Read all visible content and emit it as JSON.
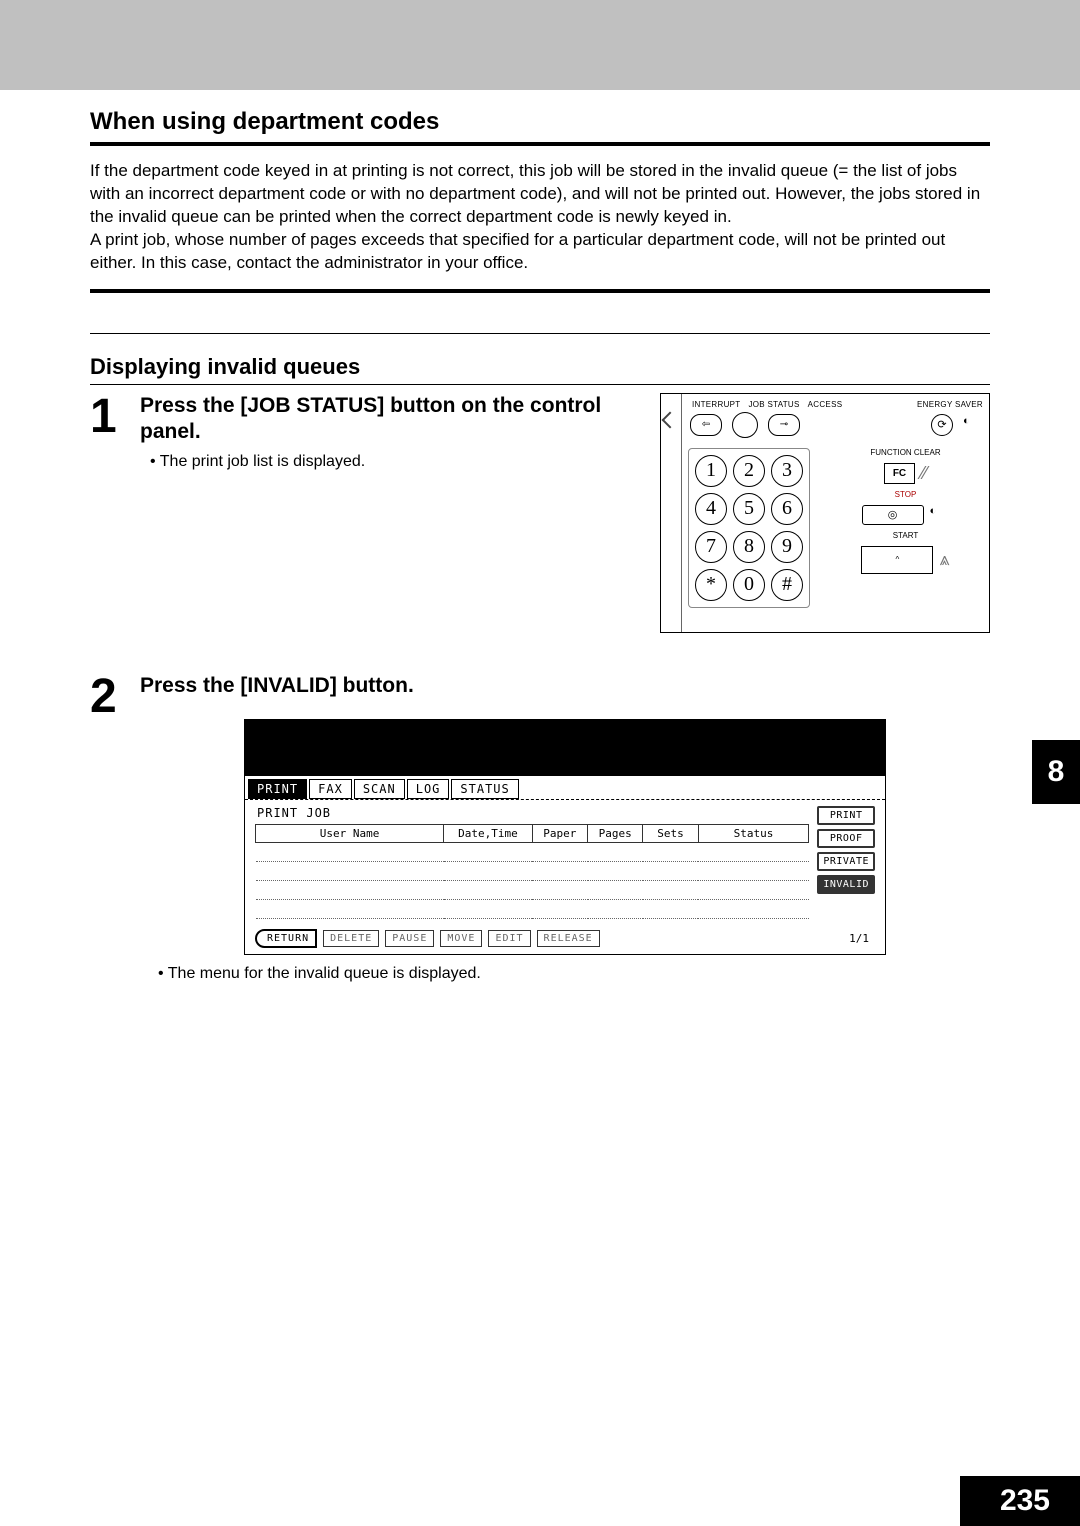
{
  "header_gray": true,
  "section1": {
    "title": "When using department codes",
    "para1": "If the department code keyed in at printing is not correct, this job will be stored in the invalid queue (= the list of jobs with an incorrect department code or with no department code), and will not be printed out. However, the jobs stored in the invalid queue can be printed when the correct department code is newly keyed in.",
    "para2": "A print job, whose number of pages exceeds that specified for a particular department code, will not be printed out either. In this case, contact the administrator in your office."
  },
  "section2": {
    "title": "Displaying invalid queues"
  },
  "step1": {
    "num": "1",
    "title": "Press the [JOB STATUS] button on the control panel.",
    "bullet": "The print job list is displayed."
  },
  "panel": {
    "labels": {
      "interrupt": "INTERRUPT",
      "jobstatus": "JOB STATUS",
      "access": "ACCESS",
      "energy": "ENERGY SAVER"
    },
    "keys": [
      "1",
      "2",
      "3",
      "4",
      "5",
      "6",
      "7",
      "8",
      "9",
      "*",
      "0",
      "#"
    ],
    "fc_label": "FUNCTION CLEAR",
    "fc": "FC",
    "stop": "STOP",
    "start": "START"
  },
  "step2": {
    "num": "2",
    "title": "Press the [INVALID] button.",
    "bullet": "The menu for the invalid queue is displayed."
  },
  "screen": {
    "tabs": [
      "PRINT",
      "FAX",
      "SCAN",
      "LOG",
      "STATUS"
    ],
    "active_tab": 0,
    "job_title": "PRINT JOB",
    "columns": [
      "User Name",
      "Date,Time",
      "Paper",
      "Pages",
      "Sets",
      "Status"
    ],
    "side_buttons": [
      "PRINT",
      "PROOF",
      "PRIVATE",
      "INVALID"
    ],
    "side_selected": 3,
    "bottom_buttons": [
      "RETURN",
      "DELETE",
      "PAUSE",
      "MOVE",
      "EDIT",
      "RELEASE"
    ],
    "page_indicator": "1/1"
  },
  "chapter": "8",
  "page_number": "235"
}
